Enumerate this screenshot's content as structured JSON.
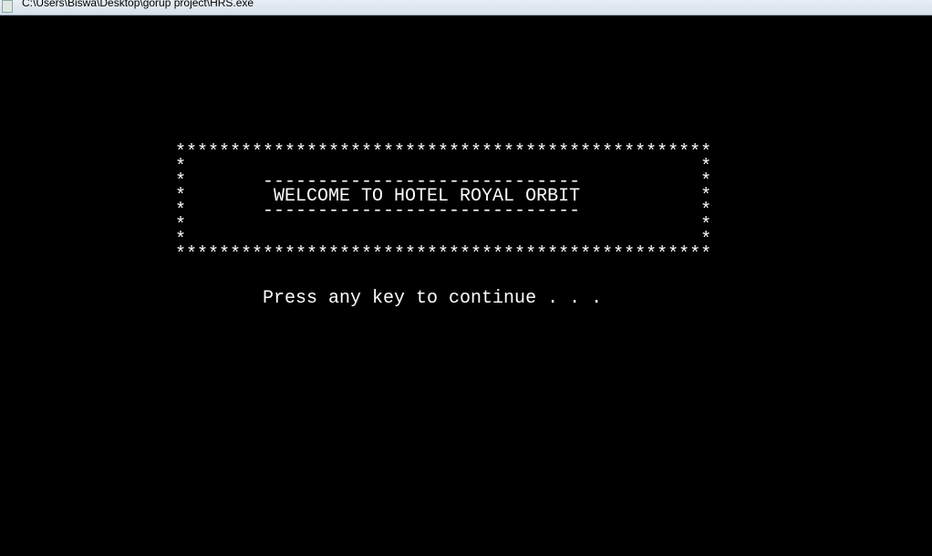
{
  "window": {
    "title": "C:\\Users\\Biswa\\Desktop\\gorup project\\HRS.exe"
  },
  "console": {
    "lines": [
      "*************************************************",
      "*                                               *",
      "*       -----------------------------           *",
      "*        WELCOME TO HOTEL ROYAL ORBIT           *",
      "*       -----------------------------           *",
      "*                                               *",
      "*                                               *",
      "*************************************************",
      "",
      "",
      "        Press any key to continue . . ."
    ]
  }
}
